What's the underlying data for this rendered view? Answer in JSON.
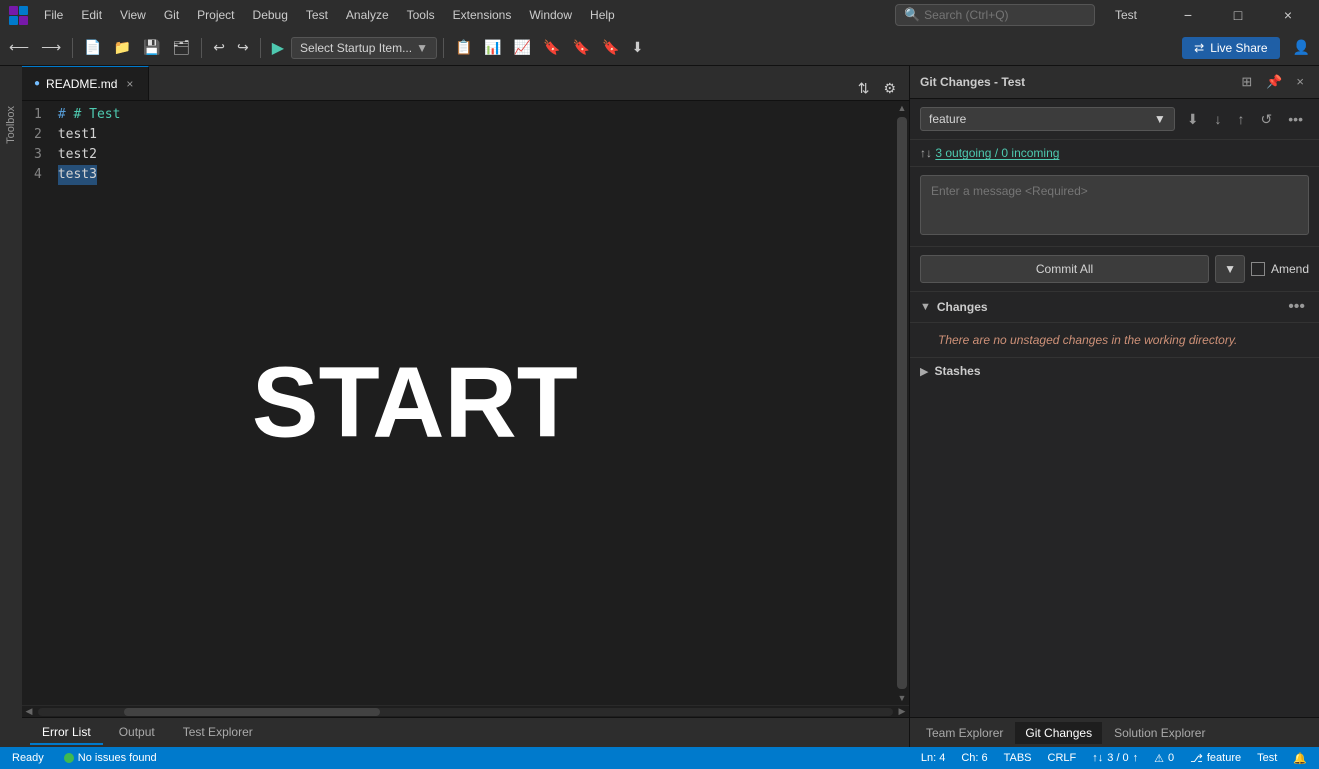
{
  "titlebar": {
    "title": "Test",
    "menu": [
      "File",
      "Edit",
      "View",
      "Git",
      "Project",
      "Debug",
      "Test",
      "Analyze",
      "Tools",
      "Extensions",
      "Window",
      "Help"
    ],
    "search_placeholder": "Search (Ctrl+Q)",
    "window_controls": [
      "−",
      "□",
      "×"
    ]
  },
  "toolbar": {
    "startup_item": "Select Startup Item...",
    "liveshare_label": "Live Share"
  },
  "editor": {
    "tab_name": "README.md",
    "lines": [
      "# Test",
      "test1",
      "test2",
      "test3"
    ],
    "line_numbers": [
      "1",
      "2",
      "3",
      "4"
    ],
    "start_text": "START",
    "cursor_info": {
      "line": "Ln: 4",
      "col": "Ch: 6",
      "tabs": "TABS",
      "crlf": "CRLF"
    }
  },
  "git_panel": {
    "title": "Git Changes - Test",
    "branch": "feature",
    "outgoing_label": "3 outgoing / 0 incoming",
    "commit_placeholder": "Enter a message <Required>",
    "commit_btn_label": "Commit All",
    "amend_label": "Amend",
    "changes_section_title": "Changes",
    "changes_empty_text": "There are no unstaged changes in the working directory.",
    "stashes_section_title": "Stashes"
  },
  "bottom_tabs": {
    "tabs": [
      "Error List",
      "Output",
      "Test Explorer"
    ]
  },
  "right_tabs": {
    "tabs": [
      "Team Explorer",
      "Git Changes",
      "Solution Explorer"
    ]
  },
  "status_bar": {
    "ready": "Ready",
    "no_issues": "No issues found",
    "source_control": "3 / 0",
    "errors": "0",
    "branch": "feature",
    "project": "Test",
    "git_arrows": "↑↓ 3/0 ↑",
    "ln": "Ln: 4",
    "ch": "Ch: 6",
    "tabs_label": "TABS",
    "crlf_label": "CRLF"
  },
  "toolbox": {
    "label": "Toolbox"
  }
}
